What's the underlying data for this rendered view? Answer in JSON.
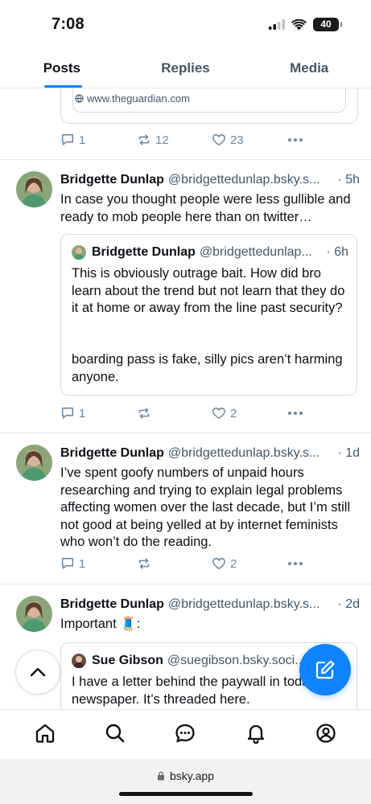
{
  "status_bar": {
    "time": "7:08",
    "battery": "40"
  },
  "tabs": [
    {
      "label": "Posts",
      "active": true
    },
    {
      "label": "Replies",
      "active": false
    },
    {
      "label": "Media",
      "active": false
    }
  ],
  "top_remnant": {
    "link_domain": "www.theguardian.com",
    "replies": "1",
    "reposts": "12",
    "likes": "23"
  },
  "posts": [
    {
      "author": "Bridgette Dunlap",
      "handle": "@bridgettedunlap.bsky.s...",
      "time": "· 5h",
      "text": "In case you thought people were less gullible and ready to mob people here than on twitter…",
      "quote": {
        "author": "Bridgette Dunlap",
        "handle": "@bridgettedunlap...",
        "time": "· 6h",
        "text_1": "This is obviously outrage bait. How did bro learn about the trend but not learn that they do it at home or away from the line past security?",
        "text_2": "boarding pass is fake, silly pics aren’t harming anyone."
      },
      "replies": "1",
      "reposts": "",
      "likes": "2"
    },
    {
      "author": "Bridgette Dunlap",
      "handle": "@bridgettedunlap.bsky.s...",
      "time": "· 1d",
      "text": "I’ve spent goofy numbers of unpaid hours researching and trying to explain legal problems affecting women over the last decade, but I’m still not good at being yelled at by internet feminists who won’t do the reading.",
      "replies": "1",
      "reposts": "",
      "likes": "2"
    },
    {
      "author": "Bridgette Dunlap",
      "handle": "@bridgettedunlap.bsky.s...",
      "time": "· 2d",
      "text": "Important 🧵:",
      "quote": {
        "author": "Sue Gibson",
        "handle": "@suegibson.bsky.soci...",
        "text": "I have a letter behind the paywall in today's newspaper. It’s threaded here."
      }
    }
  ],
  "browser": {
    "url": "bsky.app"
  },
  "colors": {
    "accent": "#1083fe",
    "muted": "#42576c",
    "icon": "#6f869f",
    "border": "#d4dbe2"
  }
}
